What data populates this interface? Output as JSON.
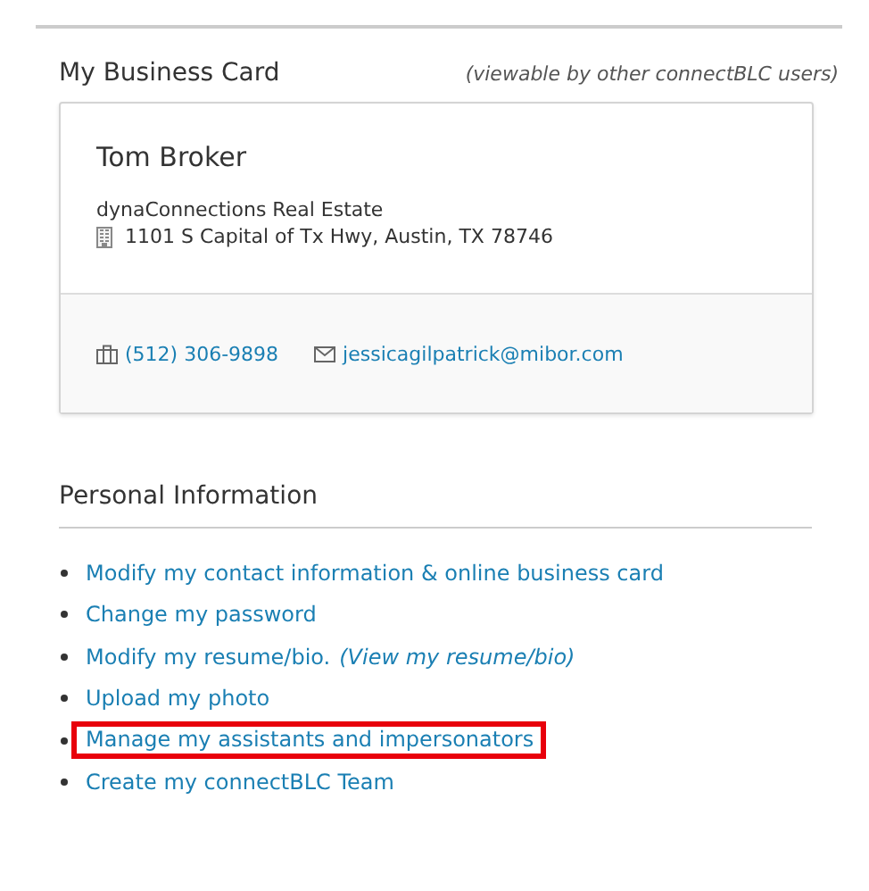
{
  "business_card": {
    "title": "My Business Card",
    "note": "(viewable by other connectBLC users)",
    "name": "Tom Broker",
    "company": "dynaConnections Real Estate",
    "address": "1101 S Capital of Tx Hwy, Austin, TX 78746",
    "phone": "(512) 306-9898",
    "email": "jessicagilpatrick@mibor.com"
  },
  "personal_information": {
    "title": "Personal Information",
    "links": [
      {
        "text": "Modify my contact information & online business card",
        "highlighted": false
      },
      {
        "text": "Change my password",
        "highlighted": false
      },
      {
        "text": "Modify my resume/bio.",
        "aside": "(View my resume/bio)",
        "highlighted": false
      },
      {
        "text": "Upload my photo",
        "highlighted": false
      },
      {
        "text": "Manage my assistants and impersonators",
        "highlighted": true
      },
      {
        "text": "Create my connectBLC Team",
        "highlighted": false
      }
    ]
  }
}
